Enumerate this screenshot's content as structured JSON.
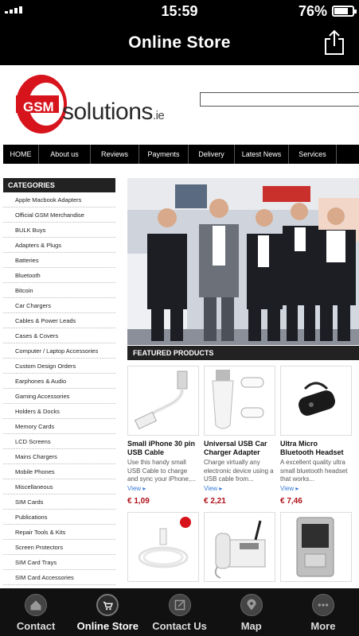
{
  "status_bar": {
    "carrier": "....",
    "time": "15:59",
    "battery_pct": "76%",
    "battery_level": 0.76
  },
  "nav": {
    "title": "Online Store",
    "share_icon": "share-icon"
  },
  "site": {
    "logo": {
      "badge": "GSM",
      "name": "solutions",
      "tld": ".ie"
    },
    "search_placeholder": "",
    "menu": [
      "HOME",
      "About us",
      "Reviews",
      "Payments",
      "Delivery",
      "Latest News",
      "Services"
    ]
  },
  "categories": {
    "heading": "CATEGORIES",
    "items": [
      "Apple Macbook Adapters",
      "Official GSM Merchandise",
      "BULK Buys",
      "Adapters & Plugs",
      "Batteries",
      "Bluetooth",
      "Bitcoin",
      "Car Chargers",
      "Cables & Power Leads",
      "Cases & Covers",
      "Computer / Laptop Accessories",
      "Custom Design Orders",
      "Earphones & Audio",
      "Gaming Accessories",
      "Holders & Docks",
      "Memory Cards",
      "LCD Screens",
      "Mains Chargers",
      "Mobile Phones",
      "Miscellaneous",
      "SIM Cards",
      "Publications",
      "Repair Tools & Kits",
      "Screen Protectors",
      "SIM Card Trays",
      "SIM Card Accessories"
    ]
  },
  "featured": {
    "heading": "FEATURED PRODUCTS",
    "products": [
      {
        "name": "Small iPhone 30 pin USB Cable",
        "desc": "Use this handy small USB Cable to charge and sync your iPhone,...",
        "view": "View",
        "price": "€ 1,09"
      },
      {
        "name": "Universal USB Car Charger Adapter",
        "desc": "Charge virtually any electronic device using a USB cable from...",
        "view": "View",
        "price": "€ 2,21"
      },
      {
        "name": "Ultra Micro Bluetooth Headset",
        "desc": "A excellent quality ultra small bluetooth headset that works...",
        "view": "View",
        "price": "€ 7,46"
      },
      {
        "name": "",
        "desc": "",
        "view": "",
        "price": ""
      },
      {
        "name": "",
        "desc": "",
        "view": "",
        "price": ""
      },
      {
        "name": "",
        "desc": "",
        "view": "",
        "price": ""
      }
    ]
  },
  "tabs": [
    {
      "label": "Contact",
      "icon": "home-icon"
    },
    {
      "label": "Online Store",
      "icon": "cart-icon",
      "active": true
    },
    {
      "label": "Contact Us",
      "icon": "edit-icon"
    },
    {
      "label": "Map",
      "icon": "map-pin-icon"
    },
    {
      "label": "More",
      "icon": "more-icon"
    }
  ]
}
